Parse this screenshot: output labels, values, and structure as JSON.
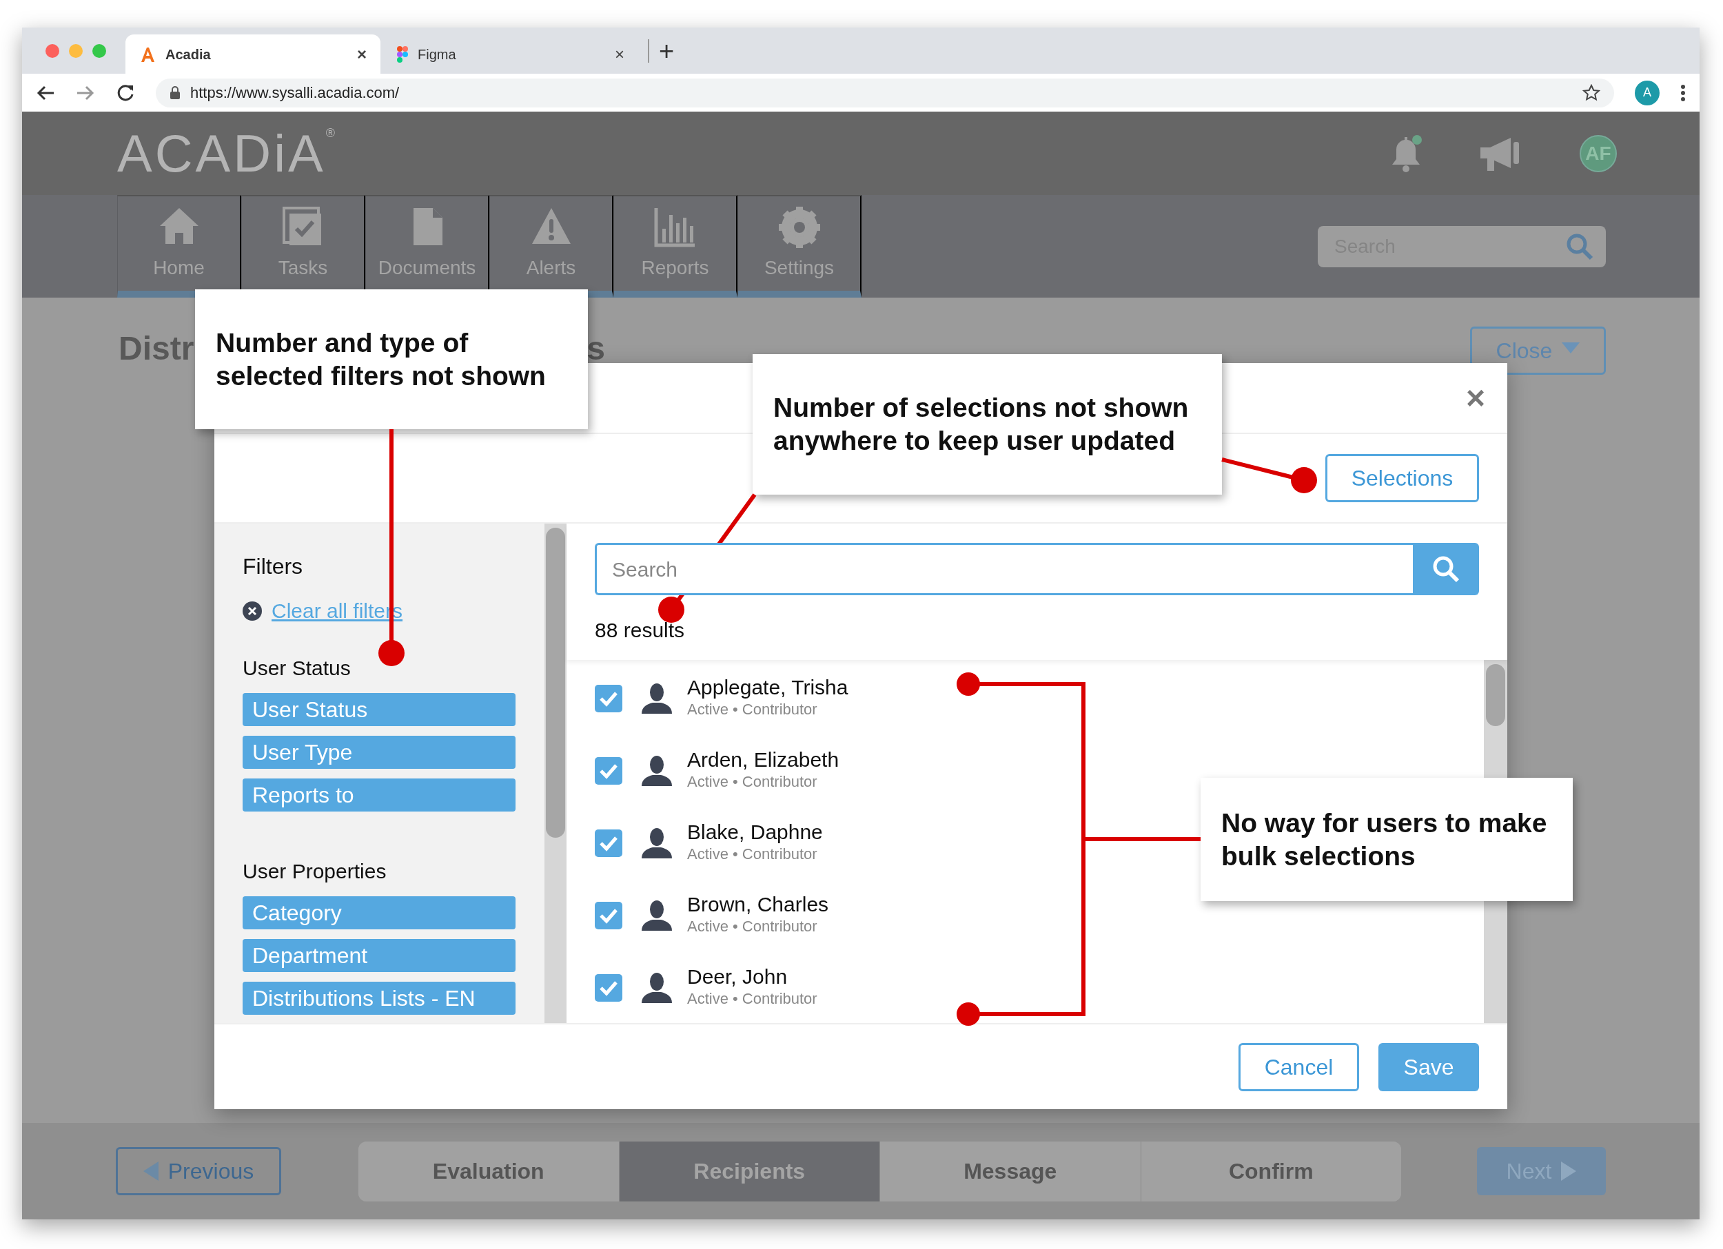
{
  "browser": {
    "tabs": [
      {
        "title": "Acadia",
        "selected": true,
        "close": "×"
      },
      {
        "title": "Figma",
        "selected": false,
        "close": "×"
      }
    ],
    "new_tab": "+",
    "url": "https://www.sysalli.acadia.com/",
    "profile": "A"
  },
  "app": {
    "logo": "ACADiA",
    "trademark": "®",
    "avatar": "AF",
    "nav": [
      {
        "label": "Home",
        "kind": "home"
      },
      {
        "label": "Tasks",
        "kind": "tasks"
      },
      {
        "label": "Documents",
        "kind": "documents"
      },
      {
        "label": "Alerts",
        "kind": "alerts"
      },
      {
        "label": "Reports",
        "kind": "reports"
      },
      {
        "label": "Settings",
        "kind": "settings"
      }
    ],
    "search": {
      "placeholder": "Search"
    }
  },
  "page": {
    "title_parts": [
      "Distr",
      "s"
    ],
    "close_button": "Close"
  },
  "modal": {
    "close": "×",
    "selections_button": "Selections",
    "filters_title": "Filters",
    "clear_filters": "Clear all filters",
    "filter_groups": [
      {
        "title": "User Status",
        "filters": [
          "User Status",
          "User Type",
          "Reports to"
        ]
      },
      {
        "title": "User Properties",
        "filters": [
          "Category",
          "Department",
          "Distributions Lists - EN"
        ]
      }
    ],
    "search": {
      "placeholder": "Search"
    },
    "results": "88 results",
    "users": [
      {
        "name": "Applegate, Trisha",
        "meta": "Active • Contributor",
        "checked": true
      },
      {
        "name": "Arden, Elizabeth",
        "meta": "Active • Contributor",
        "checked": true
      },
      {
        "name": "Blake, Daphne",
        "meta": "Active • Contributor",
        "checked": true
      },
      {
        "name": "Brown, Charles",
        "meta": "Active • Contributor",
        "checked": true
      },
      {
        "name": "Deer, John",
        "meta": "Active • Contributor",
        "checked": true
      }
    ],
    "cancel": "Cancel",
    "save": "Save"
  },
  "steps": {
    "previous": "Previous",
    "next": "Next",
    "items": [
      {
        "label": "Evaluation",
        "selected": false
      },
      {
        "label": "Recipients",
        "selected": true
      },
      {
        "label": "Message",
        "selected": false
      },
      {
        "label": "Confirm",
        "selected": false
      }
    ]
  },
  "callouts": [
    {
      "text": "Number and type of selected filters not shown"
    },
    {
      "text": "Number of selections not shown anywhere to keep user updated"
    },
    {
      "text": "No way for users to make bulk selections"
    }
  ]
}
